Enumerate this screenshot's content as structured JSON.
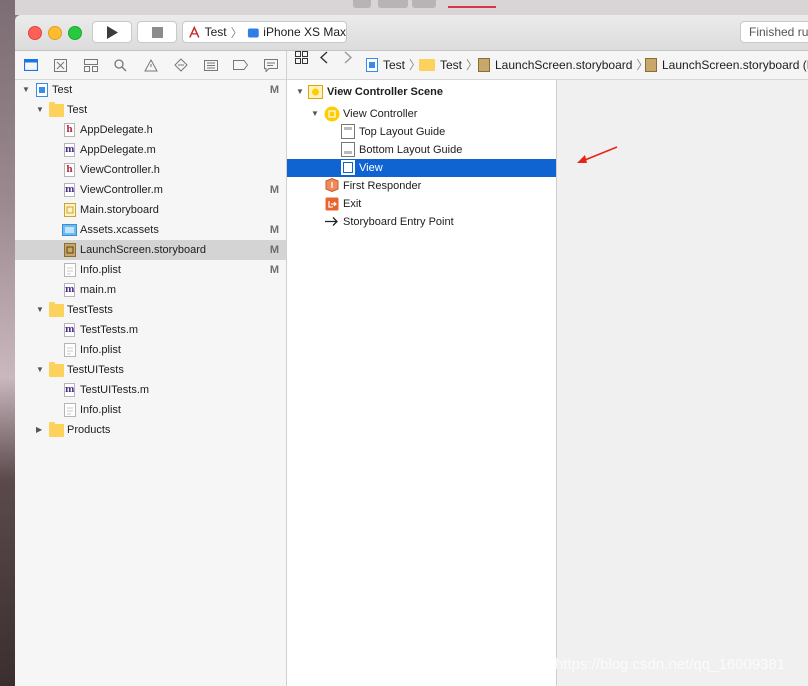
{
  "toolbar": {
    "scheme": "Test",
    "destination": "iPhone XS Max",
    "status": "Finished running"
  },
  "jumpbar": {
    "items": [
      "Test",
      "Test",
      "LaunchScreen.storyboard",
      "LaunchScreen.storyboard (Base)"
    ]
  },
  "navigator": {
    "rows": [
      {
        "label": "Test",
        "badge": "M"
      },
      {
        "label": "Test",
        "badge": ""
      },
      {
        "label": "AppDelegate.h",
        "badge": ""
      },
      {
        "label": "AppDelegate.m",
        "badge": ""
      },
      {
        "label": "ViewController.h",
        "badge": ""
      },
      {
        "label": "ViewController.m",
        "badge": "M"
      },
      {
        "label": "Main.storyboard",
        "badge": ""
      },
      {
        "label": "Assets.xcassets",
        "badge": "M"
      },
      {
        "label": "LaunchScreen.storyboard",
        "badge": "M"
      },
      {
        "label": "Info.plist",
        "badge": "M"
      },
      {
        "label": "main.m",
        "badge": ""
      },
      {
        "label": "TestTests",
        "badge": ""
      },
      {
        "label": "TestTests.m",
        "badge": ""
      },
      {
        "label": "Info.plist",
        "badge": ""
      },
      {
        "label": "TestUITests",
        "badge": ""
      },
      {
        "label": "TestUITests.m",
        "badge": ""
      },
      {
        "label": "Info.plist",
        "badge": ""
      },
      {
        "label": "Products",
        "badge": ""
      }
    ]
  },
  "outline": {
    "rows": [
      {
        "label": "View Controller Scene"
      },
      {
        "label": "View Controller"
      },
      {
        "label": "Top Layout Guide"
      },
      {
        "label": "Bottom Layout Guide"
      },
      {
        "label": "View"
      },
      {
        "label": "First Responder"
      },
      {
        "label": "Exit"
      },
      {
        "label": "Storyboard Entry Point"
      }
    ]
  },
  "watermark": "https://blog.csdn.net/qq_16009381",
  "colors": {
    "selection": "#0f64d2",
    "folder": "#fdd25c",
    "arrow": "#e8241a"
  }
}
